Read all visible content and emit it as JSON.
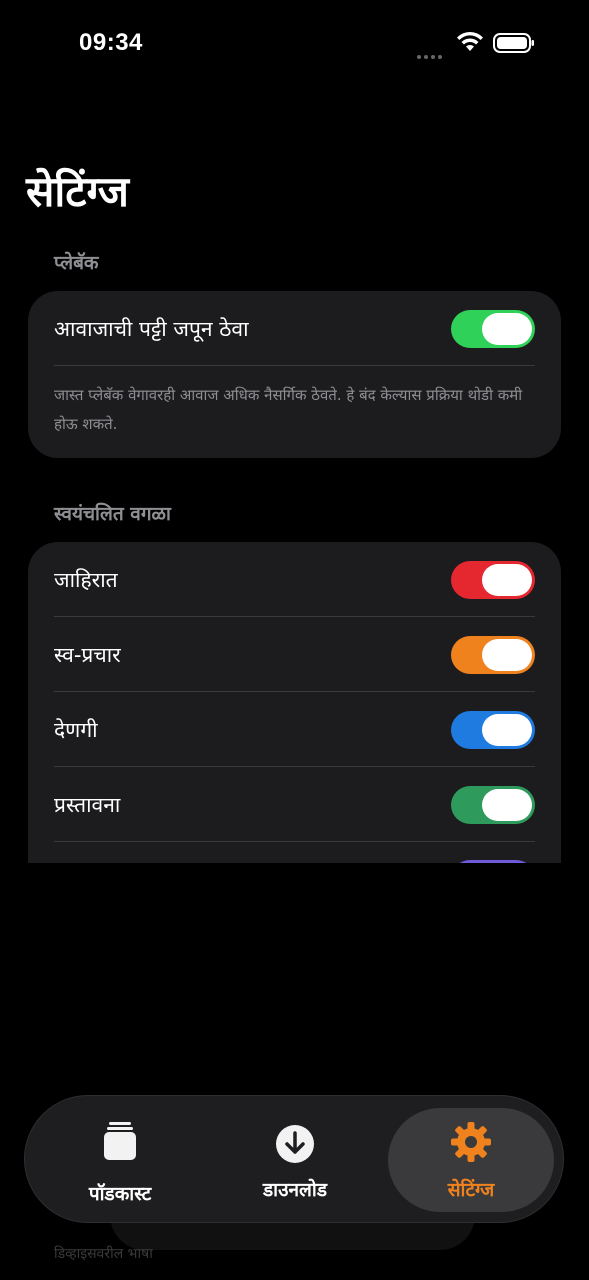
{
  "status": {
    "time": "09:34"
  },
  "page": {
    "title": "सेटिंग्ज"
  },
  "playback": {
    "section_label": "प्लेबॅक",
    "row_label": "आवाजाची पट्टी जपून ठेवा",
    "toggle_on": true,
    "toggle_color": "#30d158",
    "footnote": "जास्त प्लेबॅक वेगावरही आवाज अधिक नैसर्गिक ठेवते. हे बंद केल्यास प्रक्रिया थोडी कमी होऊ शकते."
  },
  "autoskip": {
    "section_label": "स्वयंचलित वगळा",
    "rows": [
      {
        "label": "जाहिरात",
        "on": true,
        "color": "#e5282f"
      },
      {
        "label": "स्व-प्रचार",
        "on": true,
        "color": "#f0821e"
      },
      {
        "label": "देणगी",
        "on": true,
        "color": "#1f7be0"
      },
      {
        "label": "प्रस्तावना",
        "on": true,
        "color": "#2e9b5c"
      }
    ]
  },
  "ghost_text": "डिव्हाइसवरील भाषा",
  "tabbar": {
    "tabs": [
      {
        "label": "पॉडकास्ट",
        "icon": "stack-icon",
        "active": false
      },
      {
        "label": "डाउनलोड",
        "icon": "download-icon",
        "active": false
      },
      {
        "label": "सेटिंग्ज",
        "icon": "gear-icon",
        "active": true
      }
    ],
    "active_color": "#f0821e"
  }
}
